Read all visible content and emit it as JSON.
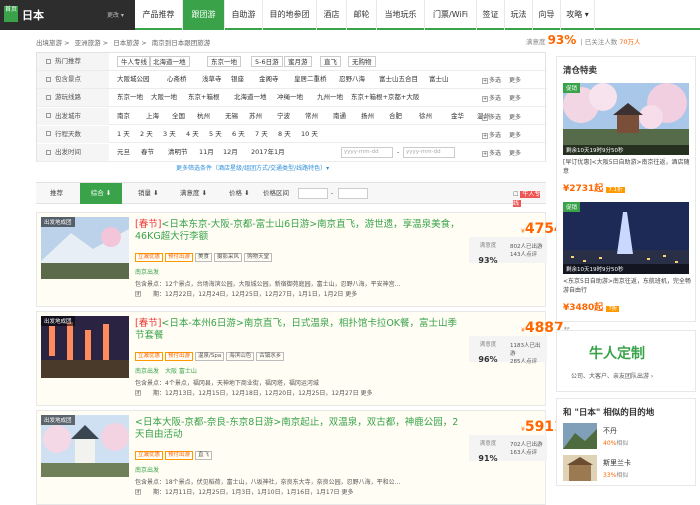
{
  "nav": {
    "city_tag": "首页",
    "city": "日本",
    "change": "更改 ▾",
    "items": [
      "产品推荐",
      "跟团游",
      "自助游",
      "目的地参团",
      "酒店",
      "邮轮",
      "当地玩乐",
      "门票/WiFi",
      "签证",
      "玩法",
      "向导",
      "攻略 ▾"
    ],
    "active": 1
  },
  "breadcrumb": [
    "出境旅游 >",
    "亚洲旅游 >",
    "日本旅游 >",
    "南京到日本跟团旅游"
  ],
  "satisfaction": {
    "label": "满意度",
    "value": "93%",
    "followers_label": "已关注人数",
    "followers": "70万人"
  },
  "filters": {
    "rows": [
      {
        "label": "热门推荐",
        "options": [
          "牛人专线",
          "北海道一地",
          "东京一地",
          "5-6日游",
          "蜜月游",
          "直飞",
          "无购物"
        ],
        "boxed": true
      },
      {
        "label": "包含景点",
        "options": [
          "大阪城公园",
          "心斋桥",
          "浅草寺",
          "银座",
          "金阁寺",
          "皇居二重桥",
          "忍野八海",
          "富士山五合目",
          "富士山"
        ],
        "multi": "多选",
        "more": "更多"
      },
      {
        "label": "游玩线路",
        "options": [
          "东京一地",
          "大阪一地",
          "东京+箱根",
          "北海道一地",
          "冲绳一地",
          "九州一地",
          "东京+箱根+京都+大阪"
        ],
        "multi": "多选",
        "more": "更多"
      },
      {
        "label": "出发城市",
        "options": [
          "南京",
          "上海",
          "全国",
          "杭州",
          "无锡",
          "苏州",
          "宁波",
          "常州",
          "南通",
          "扬州",
          "合肥",
          "徐州",
          "金华",
          "温州"
        ],
        "multi": "多选",
        "more": "更多"
      },
      {
        "label": "行程天数",
        "options": [
          "1 天",
          "2 天",
          "3 天",
          "4 天",
          "5 天",
          "6 天",
          "7 天",
          "8 天",
          "10 天"
        ],
        "multi": "多选",
        "more": "更多"
      },
      {
        "label": "出发时间",
        "options": [
          "元旦",
          "春节",
          "清明节",
          "11月",
          "12月",
          "2017年1月"
        ],
        "date_from": "yyyy-mm-dd",
        "date_to": "yyyy-mm-dd",
        "multi": "多选",
        "more": "更多"
      }
    ],
    "more_conditions": "更多筛选条件（酒店星级/组团方式/交通类型/线路特色）▾"
  },
  "sortbar": {
    "recommend": "推荐",
    "comprehensive": "综合 ⬇",
    "sales": "销量 ⬇",
    "satisfaction": "满意度 ⬇",
    "price": "价格 ⬇",
    "range": "价格区间",
    "dash": "-",
    "nuren": "牛人专线"
  },
  "products": [
    {
      "tag": "出发地成团",
      "spring": "[春节]",
      "title": "<日本东京-大阪-京都-富士山6日游>南京直飞，游世遗，享温泉美食，46KG超大行李额",
      "tags": [
        "立减优惠",
        "预付出游",
        "美食",
        "摄影采风",
        "购物天堂"
      ],
      "departure": "南京出发",
      "scenic": "包含景点：12个景点，台场海滨公园，大阪城公园，新宿御苑庭园，富士山，忍野八海，平安神宫…",
      "dates": "团　　期：12月22日，12月24日，12月25日，12月27日，1月1日，1月2日 更多",
      "sat_label": "满意度",
      "sat": "93%",
      "count1": "802人已出游",
      "count2": "143人点评",
      "price": "4754",
      "currency": "¥",
      "unit": "起"
    },
    {
      "tag": "出发地成团",
      "spring": "[春节]",
      "title": "<日本-本州6日游>南京直飞，日式温泉，相扑馆卡拉OK餐，富士山季节套餐",
      "tags": [
        "立减优惠",
        "预付出游",
        "温泉/Spa",
        "海滨山色",
        "古镇水乡"
      ],
      "departure": "南京出发　大阪 富士山",
      "scenic": "包含景点：4个景点，福冈县，天神地下商业街，福冈塔，福冈运河城",
      "dates": "团　　期：12月13日，12月15日，12月18日，12月20日，12月25日，12月27日 更多",
      "sat_label": "满意度",
      "sat": "96%",
      "count1": "1183人已出游",
      "count2": "285人点评",
      "price": "4887",
      "currency": "¥",
      "unit": "起"
    },
    {
      "tag": "出发地成团",
      "spring": "",
      "title": "<日本大阪-京都-奈良-东京8日游>南京起止，双温泉，双古都，神鹿公园，2天自由活动",
      "tags": [
        "立减优惠",
        "预付出游",
        "直飞"
      ],
      "departure": "南京出发",
      "scenic": "包含景点：18个景点，伏见稻荷，富士山，八坂神社，奈良东大寺，奈良公园，忍野八海，平和公…",
      "dates": "团　　期：12月11日，12月25日，1月3日，1月10日，1月16日，1月17日 更多",
      "sat_label": "满意度",
      "sat": "91%",
      "count1": "702人已出游",
      "count2": "163人点评",
      "price": "5911",
      "currency": "¥",
      "unit": "起"
    }
  ],
  "sidebar": {
    "sale_title": "清仓特卖",
    "deals": [
      {
        "tag": "促销",
        "caption": "剩余10天19时9分50秒",
        "text": "[早订优惠]<大阪5日自助游>南京往返，酒店随意",
        "price": "¥2731起",
        "badge": "7.1折"
      },
      {
        "tag": "促销",
        "caption": "剩余10天19时9分50秒",
        "text": "<东京5日自助游>南京往返，东航班机，完全畅游自由行",
        "price": "¥3480起",
        "badge": "7折"
      }
    ],
    "custom_title": "牛人定制",
    "custom_sub": "公司、大客户、亲友团队出游 ›",
    "similar_title": "和 \"日本\" 相似的目的地",
    "similar": [
      {
        "name": "不丹",
        "pct": "40%",
        "pct_label": "相似"
      },
      {
        "name": "斯里兰卡",
        "pct": "33%",
        "pct_label": "相似"
      }
    ]
  },
  "colors": {
    "accent": "#3aa34a",
    "price": "#ff6600",
    "spring": "#e33333"
  }
}
